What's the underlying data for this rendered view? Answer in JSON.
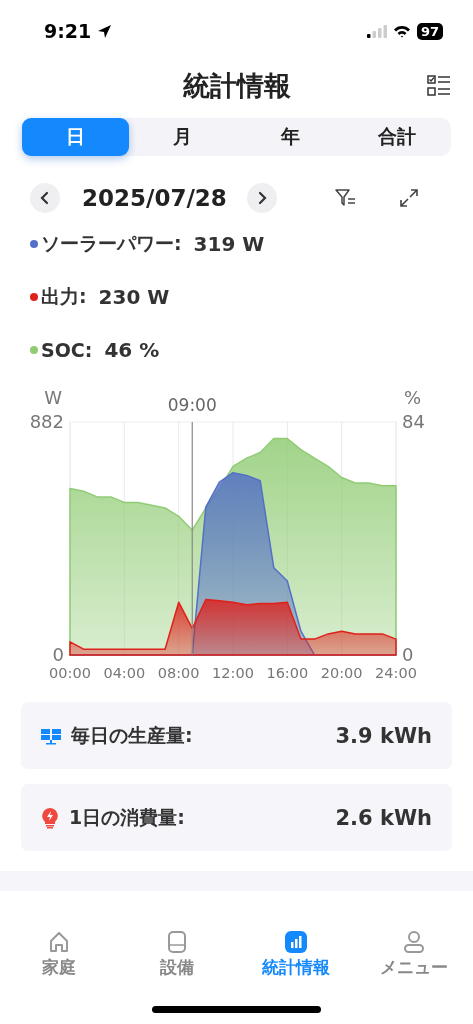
{
  "status_bar": {
    "time": "9:21",
    "battery": "97"
  },
  "header": {
    "title": "統計情報"
  },
  "period_tabs": [
    {
      "label": "日",
      "selected": true
    },
    {
      "label": "月",
      "selected": false
    },
    {
      "label": "年",
      "selected": false
    },
    {
      "label": "合計",
      "selected": false
    }
  ],
  "date_nav": {
    "date": "2025/07/28"
  },
  "legend": [
    {
      "value": "319 W"
    },
    {
      "value": "230 W"
    },
    {
      "value": "46 %"
    }
  ],
  "chart": {
    "chart_data": {
      "type": "area",
      "ref_lines": [
        {
          "axis": "x",
          "value": 9,
          "label": "09:00"
        }
      ],
      "ylabel": "W",
      "y2label": "%",
      "grid": true,
      "x": [
        0,
        1,
        2,
        3,
        4,
        5,
        6,
        7,
        8,
        9,
        10,
        11,
        12,
        13,
        14,
        15,
        16,
        17,
        18,
        19,
        20,
        21,
        22,
        23,
        24
      ],
      "xlim": [
        0,
        24
      ],
      "ylim": [
        0,
        882
      ],
      "y2lim": [
        0,
        84
      ],
      "xticks": [
        {
          "value": 0,
          "label": "00:00"
        },
        {
          "value": 4,
          "label": "04:00"
        },
        {
          "value": 8,
          "label": "08:00"
        },
        {
          "value": 12,
          "label": "12:00"
        },
        {
          "value": 16,
          "label": "16:00"
        },
        {
          "value": 20,
          "label": "20:00"
        },
        {
          "value": 24,
          "label": "24:00"
        }
      ],
      "yticks": [
        0,
        882
      ],
      "y2ticks": [
        0,
        84
      ],
      "series": [
        {
          "name": "ソーラーパワー:",
          "color": "#5470c6",
          "axis": "y",
          "values": [
            0,
            0,
            0,
            0,
            0,
            0,
            0,
            0,
            0,
            0,
            560,
            655,
            690,
            680,
            660,
            330,
            280,
            90,
            0,
            0,
            0,
            0,
            0,
            0,
            0
          ]
        },
        {
          "name": "出力:",
          "color": "#e0201b",
          "axis": "y",
          "values": [
            50,
            22,
            22,
            22,
            22,
            22,
            22,
            22,
            200,
            100,
            210,
            205,
            200,
            190,
            195,
            195,
            200,
            60,
            60,
            80,
            90,
            80,
            80,
            80,
            60
          ]
        },
        {
          "name": "SOC:",
          "color": "#91cc75",
          "axis": "y2",
          "values": [
            60,
            59,
            57,
            57,
            55,
            55,
            54,
            53,
            50,
            45,
            53,
            60,
            68,
            71,
            73,
            78,
            78,
            74,
            71,
            68,
            64,
            62,
            62,
            61,
            61
          ]
        }
      ]
    }
  },
  "summary": [
    {
      "kind": "production",
      "label": "毎日の生産量:",
      "value": "3.9 kWh"
    },
    {
      "kind": "consumption",
      "label": "1日の消費量:",
      "value": "2.6 kWh"
    }
  ],
  "tab_bar": [
    {
      "kind": "home",
      "label": "家庭",
      "selected": false
    },
    {
      "kind": "device",
      "label": "設備",
      "selected": false
    },
    {
      "kind": "stats",
      "label": "統計情報",
      "selected": true
    },
    {
      "kind": "menu",
      "label": "メニュー",
      "selected": false
    }
  ]
}
